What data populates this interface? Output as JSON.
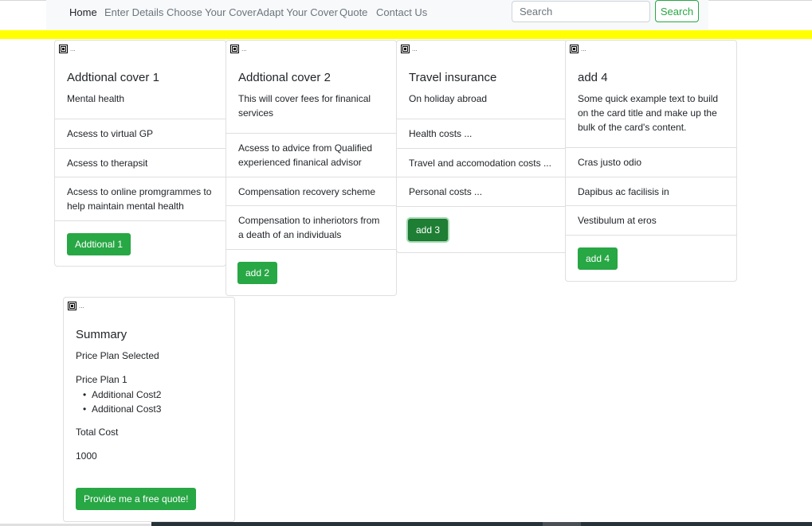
{
  "nav": {
    "links": [
      "Home",
      "Enter Details",
      "Choose Your Cover",
      "Adapt Your Cover",
      "Quote",
      "Contact Us"
    ],
    "search_placeholder": "Search",
    "search_button": "Search"
  },
  "colors": {
    "accent": "#28a745",
    "banner": "#ffff00",
    "navbar": "#f8f9fa"
  },
  "image_placeholder_text": "...",
  "cards": [
    {
      "title": "Addtional cover 1",
      "text": "Mental health",
      "items": [
        "Acsess to virtual GP",
        "Acsess to therapsit",
        "Acsess to online promgrammes to help maintain mental health"
      ],
      "button": "Addtional 1"
    },
    {
      "title": "Addtional cover 2",
      "text": "This will cover fees for finanical services",
      "items": [
        "Acsess to advice from Qualified experienced finanical advisor",
        "Compensation recovery scheme",
        "Compensation to inheriotors from a death of an individuals"
      ],
      "button": "add 2"
    },
    {
      "title": "Travel insurance",
      "text": "On holiday abroad",
      "items": [
        "Health costs ...",
        "Travel and accomodation costs ...",
        "Personal costs ..."
      ],
      "button": "add 3"
    },
    {
      "title": "add 4",
      "text": "Some quick example text to build on the card title and make up the bulk of the card's content.",
      "items": [
        "Cras justo odio",
        "Dapibus ac facilisis in",
        "Vestibulum at eros"
      ],
      "button": "add 4"
    }
  ],
  "summary": {
    "title": "Summary",
    "plan_label": "Price Plan Selected",
    "plan_name": "Price Plan 1",
    "extras": [
      "Additional Cost2",
      "Additional Cost3"
    ],
    "total_label": "Total Cost",
    "total_value": "1000",
    "button": "Provide me a free quote!"
  }
}
